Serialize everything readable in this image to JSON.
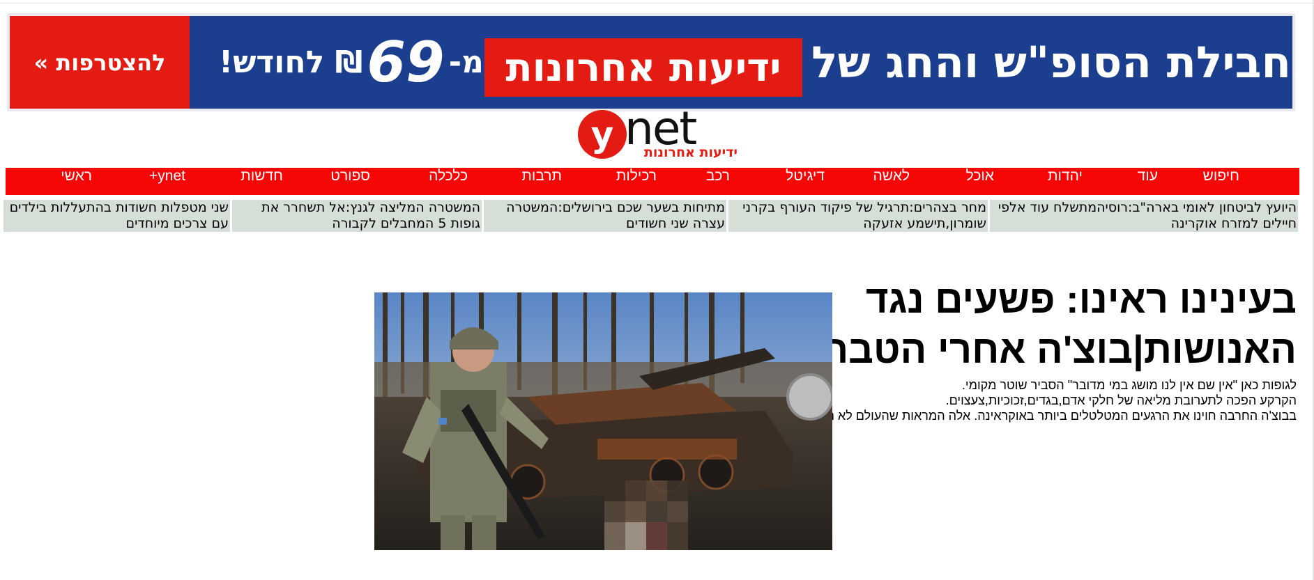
{
  "banner": {
    "cta": "להצטרפות »",
    "price_prefix": "מ-",
    "price_amount": "69",
    "price_suffix": "₪ לחודש!",
    "red_label": "ידיעות אחרונות",
    "headline": "חבילת הסופ\"ש והחג של",
    "colors": {
      "bg": "#1b3f8e",
      "red": "#e41b12"
    }
  },
  "logo": {
    "mark": "y",
    "word": "net",
    "subtitle": "ידיעות אחרונות"
  },
  "nav": {
    "items": [
      "חיפוש",
      "עוד",
      "יהדות",
      "אוכל",
      "לאשה",
      "דיגיטל",
      "רכב",
      "רכילות",
      "תרבות",
      "כלכלה",
      "ספורט",
      "חדשות",
      "ynet+",
      "ראשי"
    ]
  },
  "ticker": [
    {
      "text": "היועץ לביטחון לאומי בארה\"ב:רוסיהמתשלח עוד אלפי חיילים למזרח אוקרינה"
    },
    {
      "text": "מחר בצהרים:תרגיל של פיקוד העורף בקרני שומרון,תישמע אזעקה"
    },
    {
      "text": "מתיחות בשער שכם בירושלים:המשטרה עצרה שני חשודים"
    },
    {
      "text": "המשטרה המליצה לגנץ:אל תשחרר את גופות 5 המחבלים לקבורה"
    },
    {
      "text": "שני מטפלות חשודות בהתעללות בילדים עם צרכים מיוחדים"
    }
  ],
  "feature": {
    "title_line1": "בעינינו ראינו: פשעים נגד",
    "title_line2": "האנושות|בוצ'ה אחרי הטבח",
    "sub_line1": "לגופות כאן \"אין שם אין לנו מושג במי מדובר\" הסביר שוטר מקומי.",
    "sub_line2": "הקרקע הפכה לתערובת מליאה של חלקי אדם,בגדים,זכוכיות,צעצוים.",
    "sub_line3": "בבוצ'ה החרבה חוינו את הרגעים המטלטלים ביותר באוקראינה. אלה המראות שהעולם לא רצה לראות",
    "image_alt": "soldier-next-to-burned-vehicles"
  }
}
